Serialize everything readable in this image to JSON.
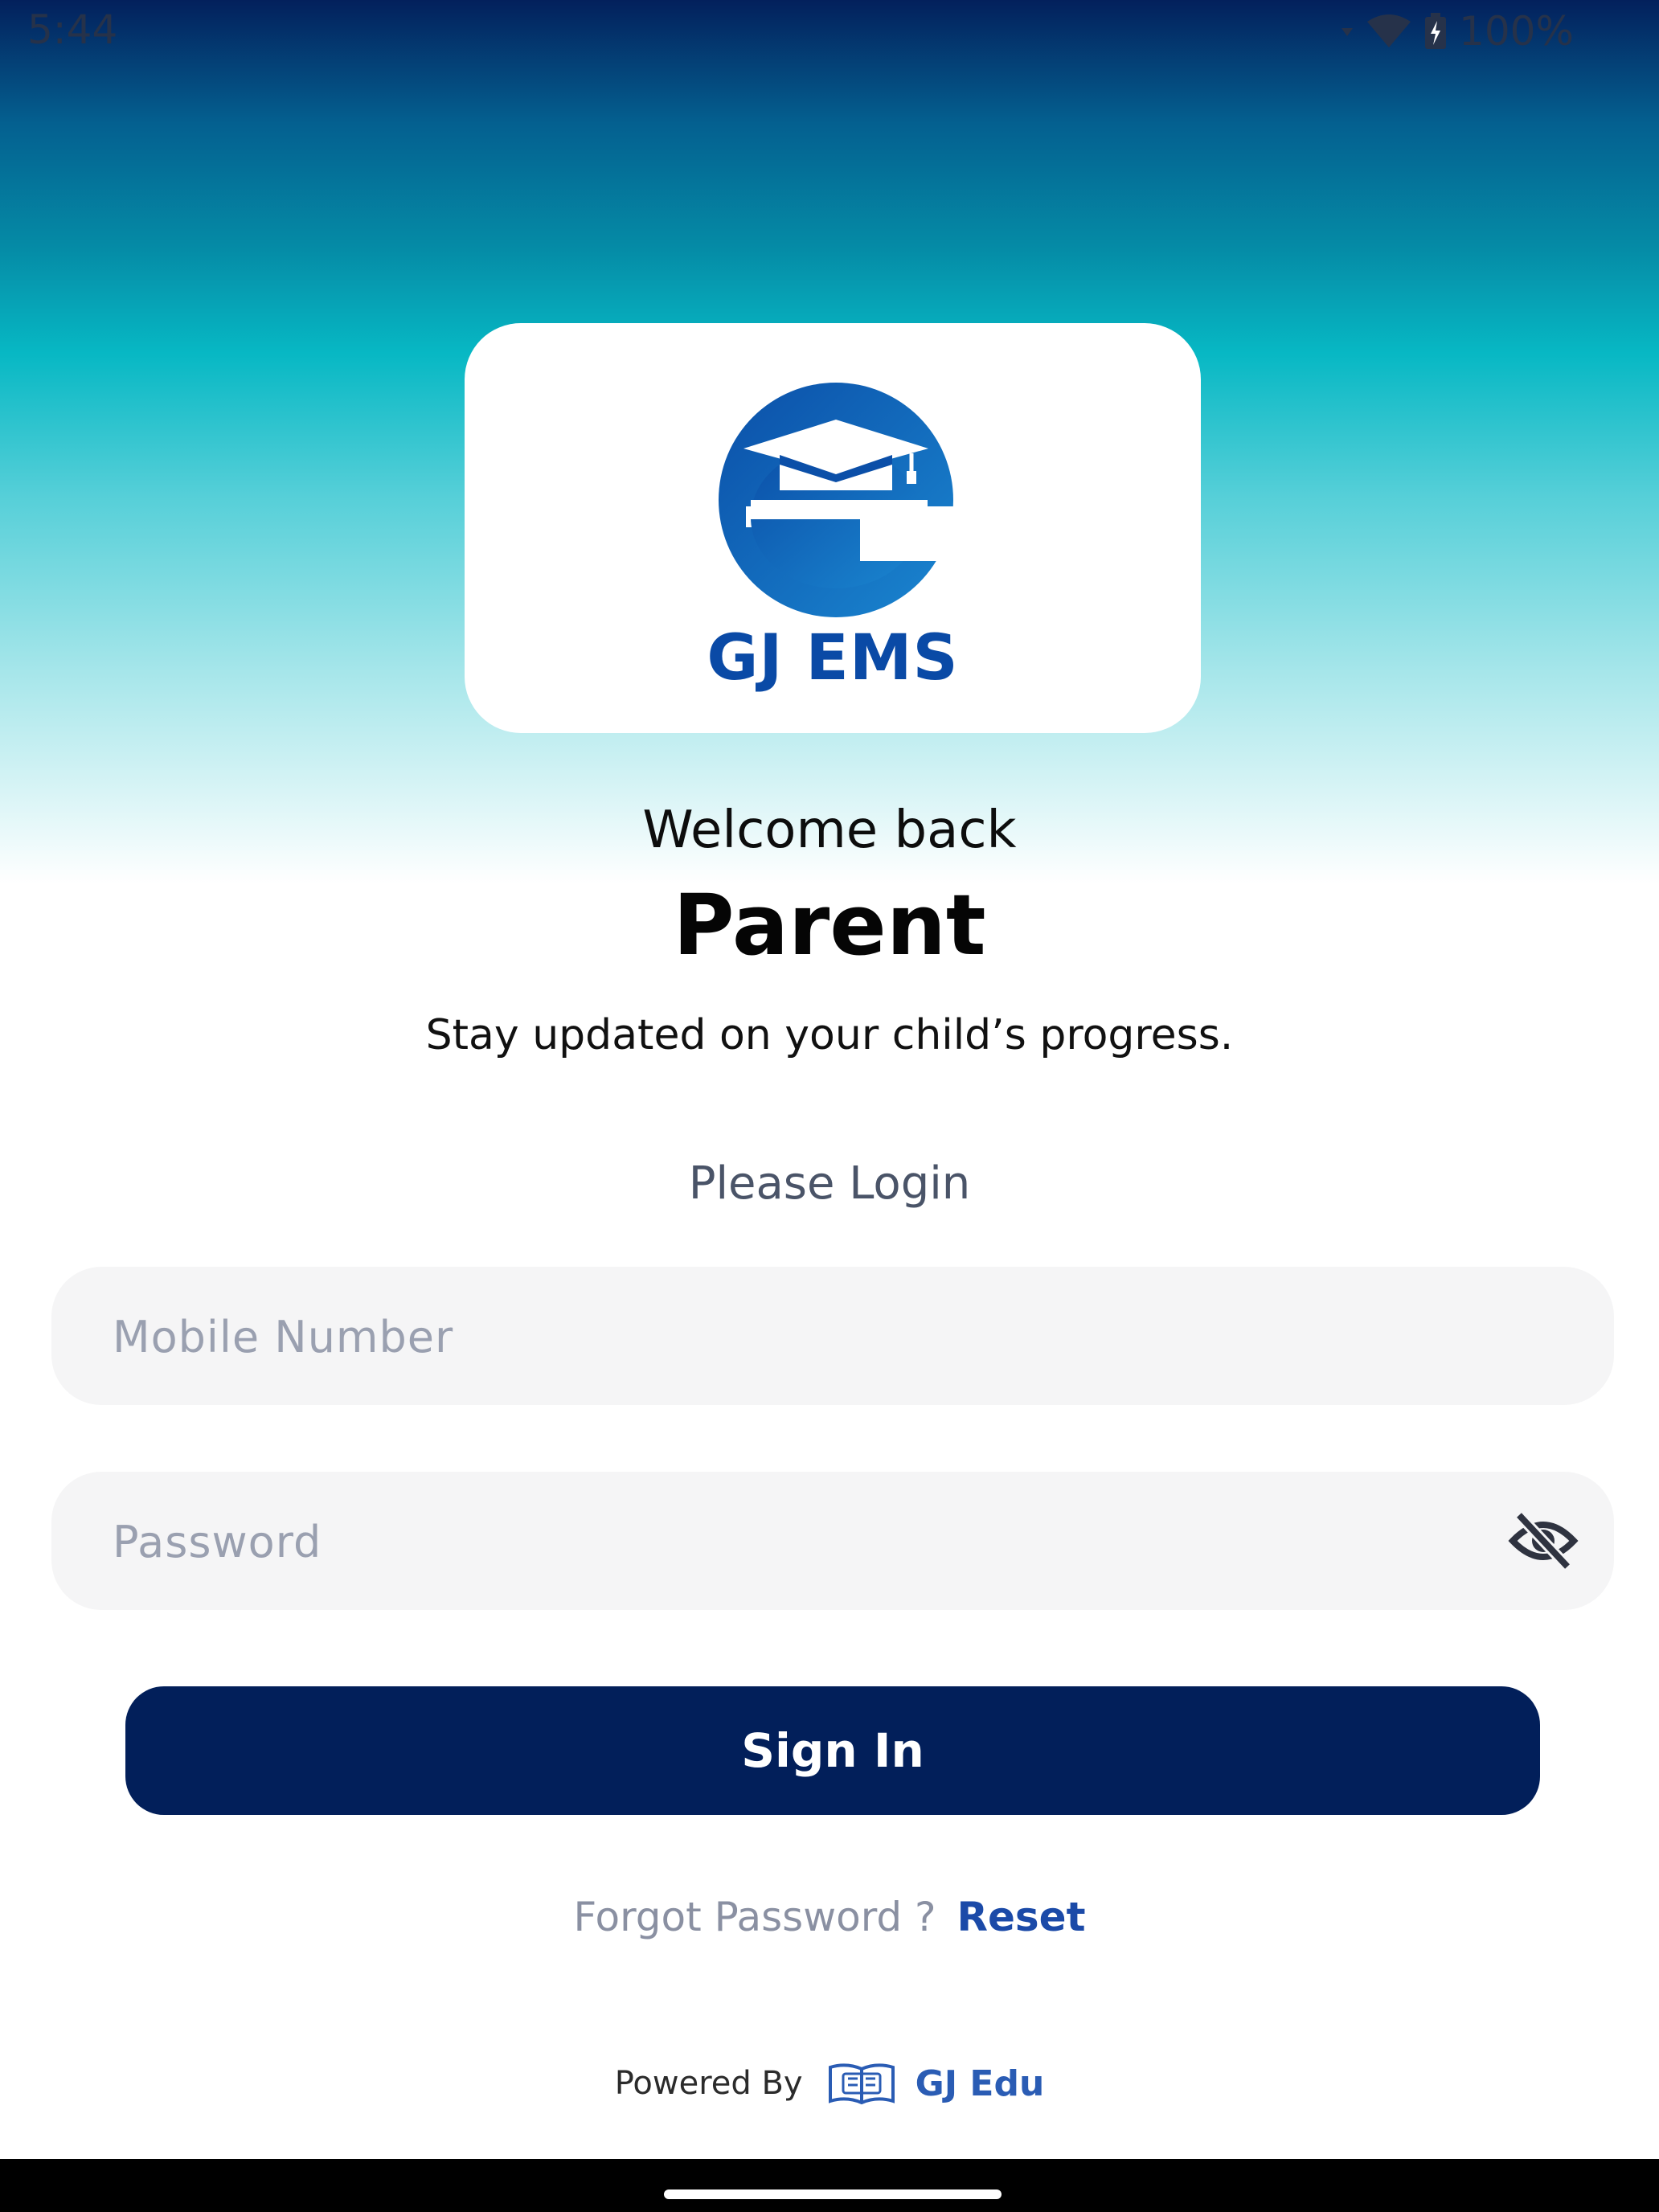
{
  "status_bar": {
    "time": "5:44",
    "battery_percent": "100%",
    "icons": [
      "signal-icon",
      "wifi-icon",
      "battery-icon"
    ]
  },
  "logo": {
    "brand_text": "GJ EMS",
    "icon": "graduation-cap-e-logo"
  },
  "welcome": {
    "greeting": "Welcome back",
    "role": "Parent",
    "tagline": "Stay updated on your child’s progress."
  },
  "login": {
    "heading": "Please Login",
    "mobile_placeholder": "Mobile Number",
    "mobile_value": "",
    "password_placeholder": "Password",
    "password_value": "",
    "password_toggle_icon": "eye-off-icon",
    "signin_label": "Sign In",
    "forgot_text": "Forgot Password ?",
    "reset_label": "Reset"
  },
  "footer": {
    "powered_by": "Powered By",
    "brand": "GJ Edu",
    "brand_icon": "open-book-icon"
  },
  "colors": {
    "primary_navy": "#021f5a",
    "brand_blue": "#0a4aa6",
    "link_blue": "#1b4aa8",
    "field_bg": "#f5f5f6",
    "gradient_top": "#03205c",
    "gradient_mid": "#07b8c4"
  }
}
